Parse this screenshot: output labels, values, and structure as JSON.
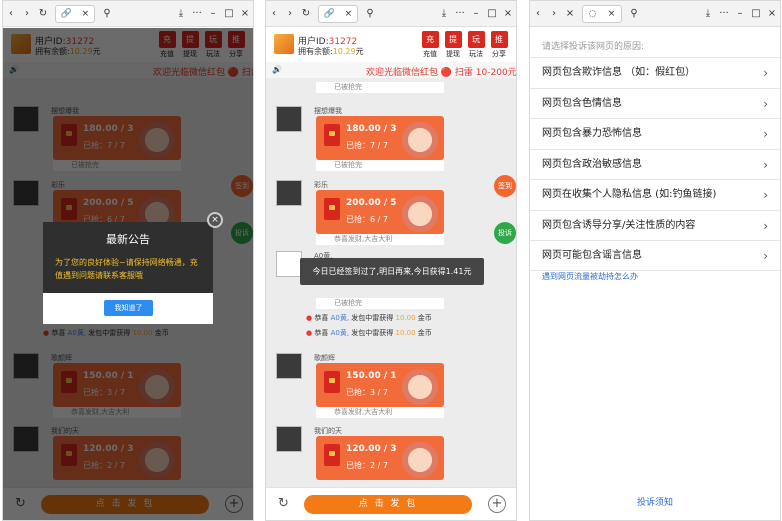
{
  "toolbar": {
    "back": "‹",
    "fwd": "›",
    "reload": "↻",
    "tab_icon": "🔗",
    "tab_close": "×",
    "search": "⚲",
    "dl": "⤓",
    "more": "···",
    "min": "–",
    "max": "□",
    "close": "×"
  },
  "toolbar3": {
    "back": "‹",
    "fwd": "›",
    "close_nav": "×",
    "tab_icon": "◌",
    "tab_close": "×",
    "search": "⚲",
    "dl": "⤓",
    "more": "···",
    "min": "–",
    "max": "□",
    "close": "×"
  },
  "app": {
    "user_id_label": "用户ID:",
    "user_id": "31272",
    "balance_label": "拥有余额:",
    "balance": "10.29",
    "balance_unit": "元",
    "header_buttons": [
      {
        "icon": "充",
        "label": "充值"
      },
      {
        "icon": "提",
        "label": "提现"
      },
      {
        "icon": "玩",
        "label": "玩法"
      },
      {
        "icon": "推",
        "label": "分享"
      }
    ],
    "marquee": "欢迎光临微信红包 🔴 扫雷 10-200元",
    "speaker_icon": "🔊",
    "floats": {
      "signin": "签到",
      "complain": "投诉"
    },
    "footer": {
      "refresh_icon": "↻",
      "send": "点 击 发 包",
      "plus": "+"
    }
  },
  "chat": {
    "messages": [
      {
        "name": "",
        "amount": "",
        "got": "",
        "footer": "已被抢完"
      },
      {
        "name": "摆想爆我",
        "amount": "180.00 / 3",
        "got": "已抢：7 / 7",
        "footer": "已被抢完"
      },
      {
        "name": "彩乐",
        "amount": "200.00 / 5",
        "got": "已抢：6 / 7",
        "footer": "恭喜发财,大吉大利"
      },
      {
        "name": "A0黄,",
        "amount": "",
        "got": "",
        "footer": "已被抢完"
      },
      {
        "name": "歌颜辉",
        "amount": "150.00 / 1",
        "got": "已抢：3 / 7",
        "footer": "恭喜发财,大吉大利"
      },
      {
        "name": "我们的天",
        "amount": "120.00 / 3",
        "got": "已抢：2 / 7",
        "footer": "恭喜发财,大吉大利"
      }
    ],
    "system": [
      {
        "pre": "恭喜 ",
        "name": "A0黄,",
        "mid": " 发包中雷获得 ",
        "gold": "10.00",
        "post": " 金币"
      },
      {
        "pre": "恭喜 ",
        "name": "A0黄,",
        "mid": " 发包中雷获得 ",
        "gold": "10.00",
        "post": " 金币"
      }
    ],
    "toast": "今日已经签到过了,明日再来,今日获得1.41元"
  },
  "notice": {
    "title": "最新公告",
    "body": "为了您的良好体验~请保持网络畅通，充值遇到问题请联系客服哦",
    "ok": "我知道了",
    "close_icon": "×"
  },
  "report": {
    "hint": "请选择投诉该网页的原因:",
    "items": [
      "网页包含欺诈信息 （如：假红包）",
      "网页包含色情信息",
      "网页包含暴力恐怖信息",
      "网页包含政治敏感信息",
      "网页在收集个人隐私信息 (如:钓鱼链接)",
      "网页包含诱导分享/关注性质的内容",
      "网页可能包含谣言信息"
    ],
    "chevron": "›",
    "link": "遇到网页流量被劫持怎么办",
    "bottom_link": "投诉须知"
  }
}
